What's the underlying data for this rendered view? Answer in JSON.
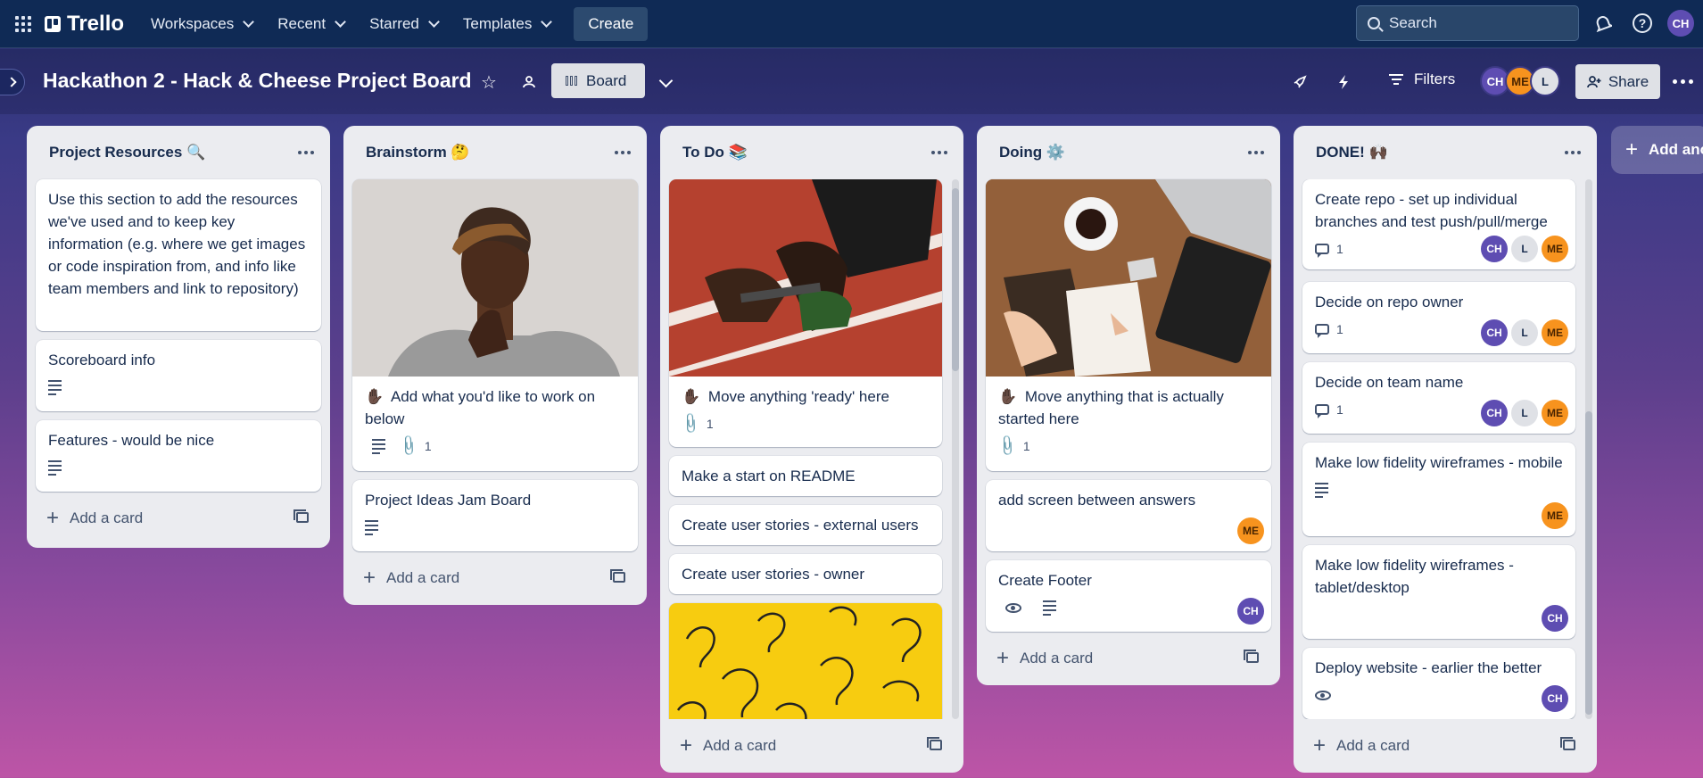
{
  "nav": {
    "logo": "Trello",
    "menus": [
      "Workspaces",
      "Recent",
      "Starred",
      "Templates"
    ],
    "create": "Create",
    "search_placeholder": "Search",
    "user_initials": "CH"
  },
  "board": {
    "title": "Hackathon 2 - Hack & Cheese Project Board",
    "view_label": "Board",
    "filters_label": "Filters",
    "share_label": "Share",
    "members": [
      "CH",
      "ME",
      "L"
    ]
  },
  "add_card_label": "Add a card",
  "add_list_label": "Add another list",
  "lists": [
    {
      "title": "Project Resources",
      "emoji": "🔍",
      "cards": [
        {
          "text": "Use this section to add the resources we've used and to keep key information (e.g. where we get images or code inspiration from, and info like team members and link to repository)"
        },
        {
          "text": "Scoreboard info",
          "badges": [
            "description"
          ]
        },
        {
          "text": "Features - would be nice",
          "badges": [
            "description"
          ]
        }
      ]
    },
    {
      "title": "Brainstorm",
      "emoji": "🤔",
      "cards": [
        {
          "cover": "person-thinking",
          "emoji": "✋🏿",
          "text": "Add what you'd like to work on below",
          "badges": [
            "description",
            "attachments"
          ],
          "attachments": "1"
        },
        {
          "text": "Project Ideas Jam Board",
          "badges": [
            "description"
          ]
        }
      ]
    },
    {
      "title": "To Do",
      "emoji": "📚",
      "cards": [
        {
          "cover": "relay-runner",
          "emoji": "✋🏿",
          "text": "Move anything 'ready' here",
          "badges": [
            "attachments"
          ],
          "attachments": "1"
        },
        {
          "text": "Make a start on README"
        },
        {
          "text": "Create user stories - external users"
        },
        {
          "text": "Create user stories - owner"
        },
        {
          "cover": "yellow-question-marks"
        }
      ]
    },
    {
      "title": "Doing",
      "emoji": "⚙️",
      "cards": [
        {
          "cover": "desk-laptop-coffee",
          "emoji": "✋🏿",
          "text": "Move anything that is actually started here",
          "badges": [
            "attachments"
          ],
          "attachments": "1"
        },
        {
          "text": "add screen between answers",
          "members": [
            "ME"
          ]
        },
        {
          "text": "Create Footer",
          "badges": [
            "watch",
            "description"
          ],
          "members": [
            "CH"
          ]
        }
      ]
    },
    {
      "title": "DONE!",
      "emoji": "🙌🏿",
      "cards": [
        {
          "text": "Create repo - set up individual branches and test push/pull/merge",
          "comments": "1",
          "members": [
            "CH",
            "L",
            "ME"
          ]
        },
        {
          "text": "Decide on repo owner",
          "comments": "1",
          "members": [
            "CH",
            "L",
            "ME"
          ]
        },
        {
          "text": "Decide on team name",
          "comments": "1",
          "members": [
            "CH",
            "L",
            "ME"
          ]
        },
        {
          "text": "Make low fidelity wireframes - mobile",
          "badges": [
            "description"
          ],
          "members": [
            "ME"
          ]
        },
        {
          "text": "Make low fidelity wireframes - tablet/desktop",
          "members": [
            "CH"
          ]
        },
        {
          "text": "Deploy website - earlier the better",
          "badges": [
            "watch"
          ],
          "members": [
            "CH"
          ]
        }
      ]
    }
  ],
  "colors": {
    "nav_bg": "#0f2a55",
    "list_bg": "#ebecf0",
    "avatar_ch": "#5e4db2",
    "avatar_me": "#f7931e",
    "avatar_l": "#dfe1e6"
  }
}
